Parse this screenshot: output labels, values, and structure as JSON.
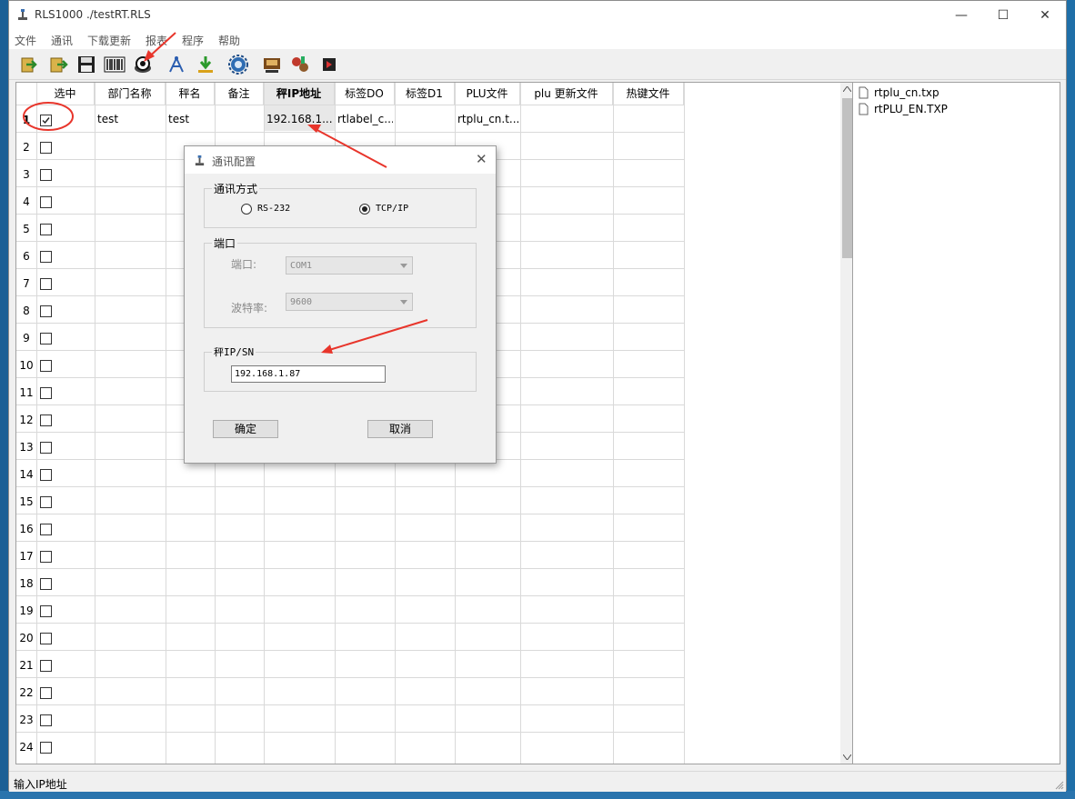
{
  "window": {
    "title": "RLS1000 ./testRT.RLS",
    "minimize_glyph": "—",
    "maximize_glyph": "☐",
    "close_glyph": "✕"
  },
  "menu": [
    "文件",
    "通讯",
    "下载更新",
    "报表",
    "程序",
    "帮助"
  ],
  "toolbar_icons": [
    "import-icon",
    "export-icon",
    "save-icon",
    "barcode-icon",
    "communication-icon",
    "network-icon",
    "download-icon",
    "settings-icon",
    "scale-icon",
    "tools-icon",
    "exit-icon"
  ],
  "grid": {
    "columns": [
      "选中",
      "部门名称",
      "秤名",
      "备注",
      "秤IP地址",
      "标签DO",
      "标签D1",
      "PLU文件",
      "plu 更新文件",
      "热键文件"
    ],
    "rows": [
      {
        "num": "1",
        "checked": true,
        "dept": "test",
        "scale": "test",
        "note": "",
        "ip": "192.168.1....",
        "label_d0": "rtlabel_c...",
        "label_d1": "",
        "plu": "rtplu_cn.t...",
        "plu_update": "",
        "hotkey": ""
      },
      {
        "num": "2",
        "checked": false
      },
      {
        "num": "3",
        "checked": false
      },
      {
        "num": "4",
        "checked": false
      },
      {
        "num": "5",
        "checked": false
      },
      {
        "num": "6",
        "checked": false
      },
      {
        "num": "7",
        "checked": false
      },
      {
        "num": "8",
        "checked": false
      },
      {
        "num": "9",
        "checked": false
      },
      {
        "num": "10",
        "checked": false
      },
      {
        "num": "11",
        "checked": false
      },
      {
        "num": "12",
        "checked": false
      },
      {
        "num": "13",
        "checked": false
      },
      {
        "num": "14",
        "checked": false
      },
      {
        "num": "15",
        "checked": false
      },
      {
        "num": "16",
        "checked": false
      },
      {
        "num": "17",
        "checked": false
      },
      {
        "num": "18",
        "checked": false
      },
      {
        "num": "19",
        "checked": false
      },
      {
        "num": "20",
        "checked": false
      },
      {
        "num": "21",
        "checked": false
      },
      {
        "num": "22",
        "checked": false
      },
      {
        "num": "23",
        "checked": false
      },
      {
        "num": "24",
        "checked": false
      }
    ]
  },
  "files": [
    "rtplu_cn.txp",
    "rtPLU_EN.TXP"
  ],
  "status": "输入IP地址",
  "dialog": {
    "title": "通讯配置",
    "comm_group": "通讯方式",
    "rs232": "RS-232",
    "tcpip": "TCP/IP",
    "selected_mode": "TCP/IP",
    "port_group": "端口",
    "port_label": "端口:",
    "port_value": "COM1",
    "baud_label": "波特率:",
    "baud_value": "9600",
    "ip_group": "秤IP/SN",
    "ip_value": "192.168.1.87",
    "ok": "确定",
    "cancel": "取消"
  },
  "colors": {
    "annotation": "#e8352b",
    "header_highlight": "#e8e8e8"
  }
}
